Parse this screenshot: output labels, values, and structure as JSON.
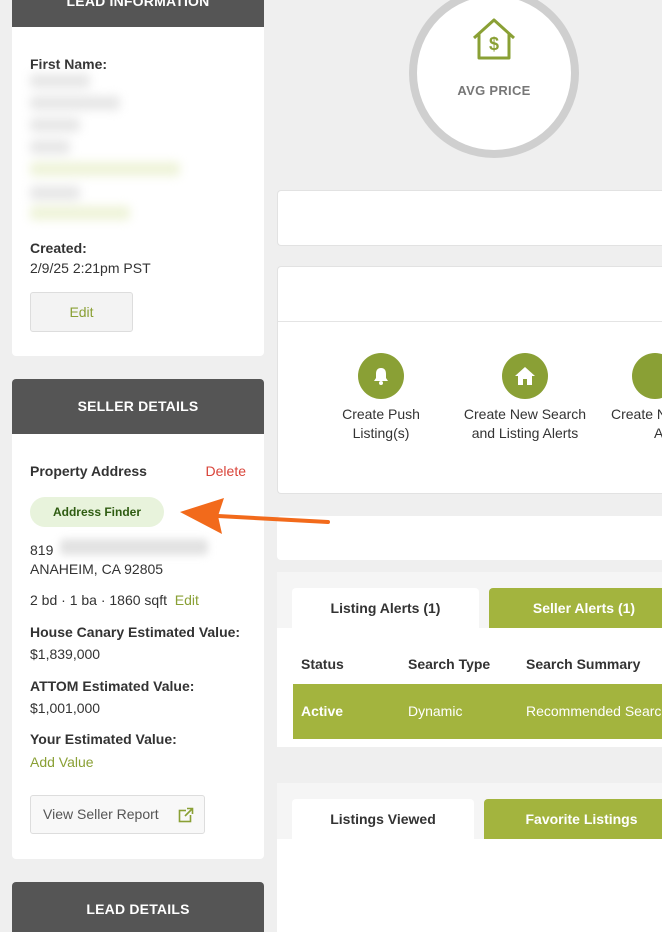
{
  "lead_info": {
    "title": "LEAD INFORMATION",
    "first_name_label": "First Name:",
    "created_label": "Created:",
    "created_value": "2/9/25 2:21pm PST",
    "edit_label": "Edit"
  },
  "seller": {
    "title": "SELLER DETAILS",
    "property_address_label": "Property Address",
    "delete_label": "Delete",
    "address_finder_label": "Address Finder",
    "street_number": "819",
    "city_line": "ANAHEIM, CA 92805",
    "specs": "2 bd · 1 ba · 1860 sqft",
    "specs_edit": "Edit",
    "house_canary_label": "House Canary Estimated Value:",
    "house_canary_value": "$1,839,000",
    "attom_label": "ATTOM Estimated Value:",
    "attom_value": "$1,001,000",
    "your_value_label": "Your Estimated Value:",
    "add_value_label": "Add Value",
    "view_report_label": "View Seller Report"
  },
  "lead_details": {
    "title": "LEAD DETAILS"
  },
  "avg_price": {
    "label": "AVG PRICE"
  },
  "actions": [
    {
      "line1": "Create Push",
      "line2": "Listing(s)"
    },
    {
      "line1": "Create New Search",
      "line2": "and Listing Alerts"
    },
    {
      "line1": "Create N",
      "line2": "A"
    }
  ],
  "alerts": {
    "tab_listing_alerts": "Listing Alerts (1)",
    "tab_seller_alerts": "Seller Alerts (1)",
    "columns": [
      "Status",
      "Search Type",
      "Search Summary"
    ],
    "row": {
      "status": "Active",
      "search_type": "Dynamic",
      "summary": "Recommended Searc"
    }
  },
  "listings": {
    "tab_viewed": "Listings Viewed",
    "tab_favorites": "Favorite Listings"
  },
  "colors": {
    "accent": "#a3b43e",
    "action_green": "#8aa035",
    "header_gray": "#555555",
    "delete_red": "#d9443a",
    "arrow_orange": "#f26a1b"
  }
}
